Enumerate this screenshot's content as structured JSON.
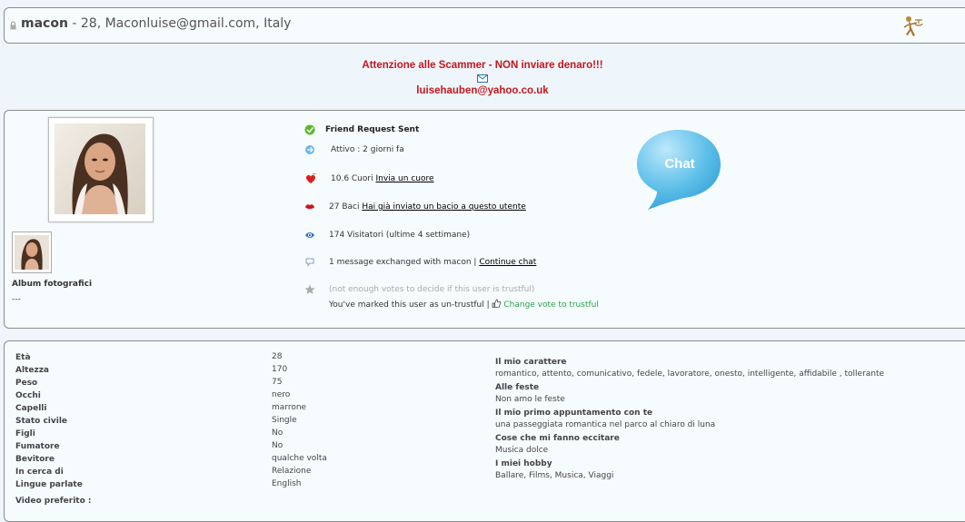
{
  "header": {
    "username": "macon",
    "details": " - 28, Maconluise@gmail.com, Italy"
  },
  "warning": {
    "line1": "Attenzione alle Scammer - NON inviare denaro!!!",
    "email": "luisehauben@yahoo.co.uk"
  },
  "profile": {
    "album_title": "Album fotografici",
    "album_value": "---",
    "friend_status": "Friend Request Sent",
    "active": "Attivo : 2 giorni fa",
    "hearts_text": "10.6 Cuori",
    "hearts_link": "Invia un cuore",
    "kisses_text": "27 Baci",
    "kisses_link": "Hai già inviato un bacio a questo utente",
    "visitors": "174 Visitatori (ultime 4 settimane)",
    "messages_text": "1 message exchanged with macon |",
    "messages_link": "Continue chat",
    "trust_info": "(not enough votes to decide if this user is trustful)",
    "trust_marked": "You've marked this user as un-trustful |",
    "trust_link": "Change vote to trustful",
    "chat_label": "Chat"
  },
  "details": {
    "attributes": [
      {
        "label": "Età",
        "value": "28"
      },
      {
        "label": "Altezza",
        "value": "170"
      },
      {
        "label": "Peso",
        "value": "75"
      },
      {
        "label": "Occhi",
        "value": "nero"
      },
      {
        "label": "Capelli",
        "value": "marrone"
      },
      {
        "label": "Stato civile",
        "value": "Single"
      },
      {
        "label": "Figli",
        "value": "No"
      },
      {
        "label": "Fumatore",
        "value": "No"
      },
      {
        "label": "Bevitore",
        "value": "qualche volta"
      },
      {
        "label": "In cerca di",
        "value": "Relazione"
      },
      {
        "label": "Lingue parlate",
        "value": "English"
      }
    ],
    "video_label": "Video preferito :",
    "character": [
      {
        "title": "Il mio carattere",
        "value": "romantico, attento, comunicativo, fedele, lavoratore, onesto, intelligente, affidabile , tollerante"
      },
      {
        "title": "Alle feste",
        "value": "Non amo le feste"
      },
      {
        "title": "Il mio primo appuntamento con te",
        "value": "una passeggiata romantica nel parco al chiaro di luna"
      },
      {
        "title": "Cose che mi fanno eccitare",
        "value": "Musica dolce"
      },
      {
        "title": "I miei hobby",
        "value": "Ballare, Films, Musica, Viaggi"
      }
    ]
  }
}
